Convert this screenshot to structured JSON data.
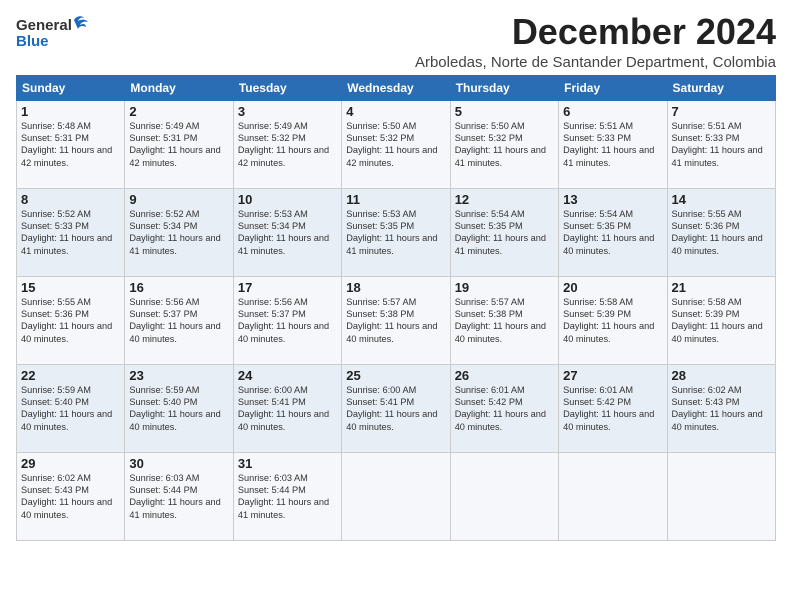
{
  "logo": {
    "general": "General",
    "blue": "Blue"
  },
  "header": {
    "month": "December 2024",
    "location": "Arboledas, Norte de Santander Department, Colombia"
  },
  "weekdays": [
    "Sunday",
    "Monday",
    "Tuesday",
    "Wednesday",
    "Thursday",
    "Friday",
    "Saturday"
  ],
  "weeks": [
    [
      {
        "day": "1",
        "sunrise": "5:48 AM",
        "sunset": "5:31 PM",
        "daylight": "11 hours and 42 minutes."
      },
      {
        "day": "2",
        "sunrise": "5:49 AM",
        "sunset": "5:31 PM",
        "daylight": "11 hours and 42 minutes."
      },
      {
        "day": "3",
        "sunrise": "5:49 AM",
        "sunset": "5:32 PM",
        "daylight": "11 hours and 42 minutes."
      },
      {
        "day": "4",
        "sunrise": "5:50 AM",
        "sunset": "5:32 PM",
        "daylight": "11 hours and 42 minutes."
      },
      {
        "day": "5",
        "sunrise": "5:50 AM",
        "sunset": "5:32 PM",
        "daylight": "11 hours and 41 minutes."
      },
      {
        "day": "6",
        "sunrise": "5:51 AM",
        "sunset": "5:33 PM",
        "daylight": "11 hours and 41 minutes."
      },
      {
        "day": "7",
        "sunrise": "5:51 AM",
        "sunset": "5:33 PM",
        "daylight": "11 hours and 41 minutes."
      }
    ],
    [
      {
        "day": "8",
        "sunrise": "5:52 AM",
        "sunset": "5:33 PM",
        "daylight": "11 hours and 41 minutes."
      },
      {
        "day": "9",
        "sunrise": "5:52 AM",
        "sunset": "5:34 PM",
        "daylight": "11 hours and 41 minutes."
      },
      {
        "day": "10",
        "sunrise": "5:53 AM",
        "sunset": "5:34 PM",
        "daylight": "11 hours and 41 minutes."
      },
      {
        "day": "11",
        "sunrise": "5:53 AM",
        "sunset": "5:35 PM",
        "daylight": "11 hours and 41 minutes."
      },
      {
        "day": "12",
        "sunrise": "5:54 AM",
        "sunset": "5:35 PM",
        "daylight": "11 hours and 41 minutes."
      },
      {
        "day": "13",
        "sunrise": "5:54 AM",
        "sunset": "5:35 PM",
        "daylight": "11 hours and 40 minutes."
      },
      {
        "day": "14",
        "sunrise": "5:55 AM",
        "sunset": "5:36 PM",
        "daylight": "11 hours and 40 minutes."
      }
    ],
    [
      {
        "day": "15",
        "sunrise": "5:55 AM",
        "sunset": "5:36 PM",
        "daylight": "11 hours and 40 minutes."
      },
      {
        "day": "16",
        "sunrise": "5:56 AM",
        "sunset": "5:37 PM",
        "daylight": "11 hours and 40 minutes."
      },
      {
        "day": "17",
        "sunrise": "5:56 AM",
        "sunset": "5:37 PM",
        "daylight": "11 hours and 40 minutes."
      },
      {
        "day": "18",
        "sunrise": "5:57 AM",
        "sunset": "5:38 PM",
        "daylight": "11 hours and 40 minutes."
      },
      {
        "day": "19",
        "sunrise": "5:57 AM",
        "sunset": "5:38 PM",
        "daylight": "11 hours and 40 minutes."
      },
      {
        "day": "20",
        "sunrise": "5:58 AM",
        "sunset": "5:39 PM",
        "daylight": "11 hours and 40 minutes."
      },
      {
        "day": "21",
        "sunrise": "5:58 AM",
        "sunset": "5:39 PM",
        "daylight": "11 hours and 40 minutes."
      }
    ],
    [
      {
        "day": "22",
        "sunrise": "5:59 AM",
        "sunset": "5:40 PM",
        "daylight": "11 hours and 40 minutes."
      },
      {
        "day": "23",
        "sunrise": "5:59 AM",
        "sunset": "5:40 PM",
        "daylight": "11 hours and 40 minutes."
      },
      {
        "day": "24",
        "sunrise": "6:00 AM",
        "sunset": "5:41 PM",
        "daylight": "11 hours and 40 minutes."
      },
      {
        "day": "25",
        "sunrise": "6:00 AM",
        "sunset": "5:41 PM",
        "daylight": "11 hours and 40 minutes."
      },
      {
        "day": "26",
        "sunrise": "6:01 AM",
        "sunset": "5:42 PM",
        "daylight": "11 hours and 40 minutes."
      },
      {
        "day": "27",
        "sunrise": "6:01 AM",
        "sunset": "5:42 PM",
        "daylight": "11 hours and 40 minutes."
      },
      {
        "day": "28",
        "sunrise": "6:02 AM",
        "sunset": "5:43 PM",
        "daylight": "11 hours and 40 minutes."
      }
    ],
    [
      {
        "day": "29",
        "sunrise": "6:02 AM",
        "sunset": "5:43 PM",
        "daylight": "11 hours and 40 minutes."
      },
      {
        "day": "30",
        "sunrise": "6:03 AM",
        "sunset": "5:44 PM",
        "daylight": "11 hours and 41 minutes."
      },
      {
        "day": "31",
        "sunrise": "6:03 AM",
        "sunset": "5:44 PM",
        "daylight": "11 hours and 41 minutes."
      },
      null,
      null,
      null,
      null
    ]
  ]
}
